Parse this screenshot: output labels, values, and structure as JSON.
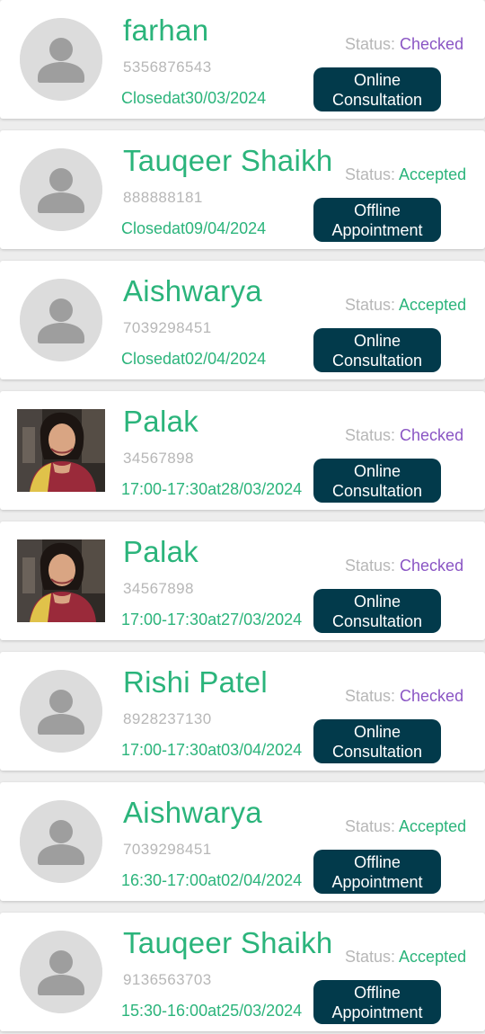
{
  "appointments": [
    {
      "name": "farhan",
      "phone": "5356876543",
      "time": "Closedat30/03/2024",
      "status_label": "Status: ",
      "status_value": "Checked",
      "status_kind": "checked",
      "type_line1": "Online",
      "type_line2": "Consultation",
      "avatar": "default-avatar-icon"
    },
    {
      "name": "Tauqeer Shaikh",
      "phone": "888888181",
      "time": "Closedat09/04/2024",
      "status_label": "Status: ",
      "status_value": "Accepted",
      "status_kind": "accepted",
      "type_line1": "Offline",
      "type_line2": "Appointment",
      "avatar": "default-avatar-icon"
    },
    {
      "name": "Aishwarya",
      "phone": "7039298451",
      "time": "Closedat02/04/2024",
      "status_label": "Status: ",
      "status_value": "Accepted",
      "status_kind": "accepted",
      "type_line1": "Online",
      "type_line2": "Consultation",
      "avatar": "default-avatar-icon"
    },
    {
      "name": "Palak",
      "phone": "34567898",
      "time": "17:00-17:30at28/03/2024",
      "status_label": "Status: ",
      "status_value": "Checked",
      "status_kind": "checked",
      "type_line1": "Online",
      "type_line2": "Consultation",
      "avatar": "profile-photo"
    },
    {
      "name": "Palak",
      "phone": "34567898",
      "time": "17:00-17:30at27/03/2024",
      "status_label": "Status: ",
      "status_value": "Checked",
      "status_kind": "checked",
      "type_line1": "Online",
      "type_line2": "Consultation",
      "avatar": "profile-photo"
    },
    {
      "name": "Rishi Patel",
      "phone": "8928237130",
      "time": "17:00-17:30at03/04/2024",
      "status_label": "Status: ",
      "status_value": "Checked",
      "status_kind": "checked",
      "type_line1": "Online",
      "type_line2": "Consultation",
      "avatar": "default-avatar-icon"
    },
    {
      "name": "Aishwarya",
      "phone": "7039298451",
      "time": "16:30-17:00at02/04/2024",
      "status_label": "Status: ",
      "status_value": "Accepted",
      "status_kind": "accepted",
      "type_line1": "Offline",
      "type_line2": "Appointment",
      "avatar": "default-avatar-icon"
    },
    {
      "name": "Tauqeer Shaikh",
      "phone": "9136563703",
      "time": "15:30-16:00at25/03/2024",
      "status_label": "Status: ",
      "status_value": "Accepted",
      "status_kind": "accepted",
      "type_line1": "Offline",
      "type_line2": "Appointment",
      "avatar": "default-avatar-icon"
    }
  ],
  "colors": {
    "accent_green": "#2bb47b",
    "checked_purple": "#8a55c4",
    "button_bg": "#023a4b",
    "muted_text": "#b7b7b7",
    "page_bg": "#ededed"
  }
}
